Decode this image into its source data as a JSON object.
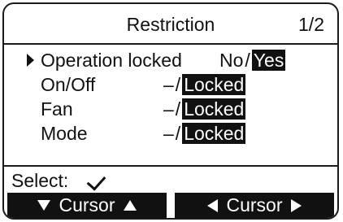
{
  "header": {
    "title": "Restriction",
    "page": "1/2"
  },
  "rows": [
    {
      "label": "Operation locked",
      "option_off": "No",
      "sep": "/",
      "option_on": "Yes",
      "selected": true
    },
    {
      "label": "On/Off",
      "option_off": "–",
      "sep": "/",
      "option_on": "Locked",
      "selected": false
    },
    {
      "label": "Fan",
      "option_off": "–",
      "sep": "/",
      "option_on": "Locked",
      "selected": false
    },
    {
      "label": "Mode",
      "option_off": "–",
      "sep": "/",
      "option_on": "Locked",
      "selected": false
    }
  ],
  "footer": {
    "select_label": "Select:",
    "select_icon": "check-icon",
    "buttons": [
      {
        "label": "Cursor",
        "icons": [
          "down-arrow-icon",
          "up-arrow-icon"
        ]
      },
      {
        "label": "Cursor",
        "icons": [
          "left-arrow-icon",
          "right-arrow-icon"
        ]
      }
    ]
  },
  "colors": {
    "foreground": "#111111",
    "background": "#ffffff",
    "highlight_text": "#ffffff"
  }
}
